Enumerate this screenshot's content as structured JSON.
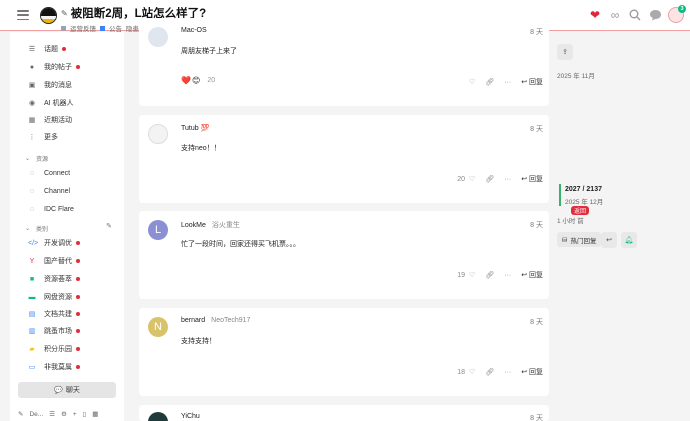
{
  "header": {
    "title": "被阻断2周，L站怎么样了?",
    "category": "运营反馈",
    "tag_1": "公告",
    "tag_2": "隐患排查",
    "badge_count": "3"
  },
  "sidebar": {
    "items": [
      {
        "label": "话题",
        "icon": "list-icon",
        "dot": true
      },
      {
        "label": "我的帖子",
        "icon": "user-icon",
        "dot": true
      },
      {
        "label": "我的消息",
        "icon": "inbox-icon",
        "dot": false
      },
      {
        "label": "AI 机器人",
        "icon": "robot-icon",
        "dot": false
      },
      {
        "label": "近期活动",
        "icon": "calendar-icon",
        "dot": false
      },
      {
        "label": "更多",
        "icon": "more-vertical-icon",
        "dot": false
      }
    ],
    "resources_header": "资源",
    "resources": [
      {
        "label": "Connect",
        "icon": "circle-icon"
      },
      {
        "label": "Channel",
        "icon": "circle-icon"
      },
      {
        "label": "IDC Flare",
        "icon": "circle-icon"
      }
    ],
    "categories_header": "类别",
    "categories": [
      {
        "label": "开发调优",
        "icon": "code-icon",
        "color": "#3b82f6"
      },
      {
        "label": "国产替代",
        "icon": "branch-icon",
        "color": "#e02d3c"
      },
      {
        "label": "资源荟萃",
        "icon": "box-icon",
        "color": "#10b981"
      },
      {
        "label": "网盘资源",
        "icon": "drive-icon",
        "color": "#10b981"
      },
      {
        "label": "文档共建",
        "icon": "document-icon",
        "color": "#3b82f6"
      },
      {
        "label": "跳蚤市场",
        "icon": "shop-icon",
        "color": "#3b82f6"
      },
      {
        "label": "积分乐园",
        "icon": "folder-icon",
        "color": "#f5c518"
      },
      {
        "label": "非我莫属",
        "icon": "briefcase-icon",
        "color": "#3b82f6"
      }
    ],
    "chat_label": "聊天",
    "footer_label": "De..."
  },
  "posts": [
    {
      "author": "Mac-OS",
      "time": "8 天",
      "body": "周朋友梯子上来了",
      "likes": "20",
      "reply": "回复"
    },
    {
      "author": "Tutub",
      "badge": "💯",
      "time": "8 天",
      "body": "支持neo！！",
      "likes": "20",
      "reply": "回复"
    },
    {
      "author": "LookMe",
      "secondary": "浴火重生",
      "initial": "L",
      "time": "8 天",
      "body": "忙了一段时间，回家还得买飞机票。。。",
      "likes": "19",
      "reply": "回复"
    },
    {
      "author": "bernard",
      "secondary": "NeoTech917",
      "initial": "N",
      "time": "8 天",
      "body": "支持支持！",
      "likes": "18",
      "reply": "回复"
    },
    {
      "author": "YiChu",
      "time": "8 天"
    }
  ],
  "timeline": {
    "start_date": "2025 年 11月",
    "position": "2027 / 2137",
    "position_date": "2025 年 12月",
    "return_label": "返回",
    "ago": "1 小时 前",
    "hot_label": "热门回复"
  },
  "colors": {
    "accent": "#e02d3c",
    "progress": "#3ab06f"
  }
}
